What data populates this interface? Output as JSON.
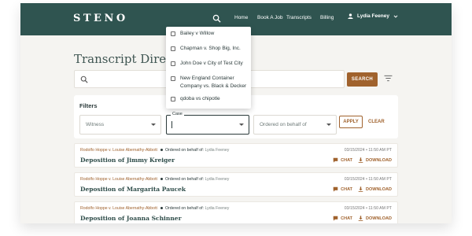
{
  "header": {
    "logo": "STENO",
    "nav": [
      "Home",
      "Book A Job",
      "Transcripts",
      "Billing"
    ],
    "user_name": "Lydia Feeney"
  },
  "page": {
    "title": "Transcript Directory"
  },
  "search": {
    "button_label": "SEARCH"
  },
  "filters": {
    "heading": "Filters",
    "witness_placeholder": "Witness",
    "case_label": "Case",
    "ordered_placeholder": "Ordered on behalf of",
    "apply_label": "APPLY",
    "clear_label": "CLEAR"
  },
  "case_dropdown": {
    "options": [
      "Bailey v Willow",
      "Chapman v. Shop Big, Inc.",
      "John Doe v City of Test City",
      "New England Container Company vs. Black & Decker",
      "qdoba vs chipotle"
    ]
  },
  "transcripts": [
    {
      "parties": "Rodolfo Hoppe v. Louise Abernathy-Abbott",
      "ordered_label": "Ordered on behalf of:",
      "ordered_by": "Lydia Feeney",
      "title": "Deposition of Jimmy Kreiger",
      "date": "03/15/2024 • 11:50 AM PT",
      "chat_label": "CHAT",
      "download_label": "DOWNLOAD"
    },
    {
      "parties": "Rodolfo Hoppe v. Louise Abernathy-Abbott",
      "ordered_label": "Ordered on behalf of:",
      "ordered_by": "Lydia Feeney",
      "title": "Deposition of Margarita Paucek",
      "date": "03/15/2024 • 11:50 AM PT",
      "chat_label": "CHAT",
      "download_label": "DOWNLOAD"
    },
    {
      "parties": "Rodolfo Hoppe v. Louise Abernathy-Abbott",
      "ordered_label": "Ordered on behalf of:",
      "ordered_by": "Lydia Feeney",
      "title": "Deposition of Joanna Schinner",
      "date": "03/15/2024 • 11:50 AM PT",
      "chat_label": "CHAT",
      "download_label": "DOWNLOAD"
    }
  ],
  "colors": {
    "header_bg": "#2f5450",
    "accent": "#a0622d",
    "page_bg": "#f5f4f1"
  },
  "icons": [
    "search-icon",
    "user-icon",
    "chevron-down-icon",
    "filter-icon",
    "chat-icon",
    "download-icon",
    "checkbox-icon"
  ]
}
